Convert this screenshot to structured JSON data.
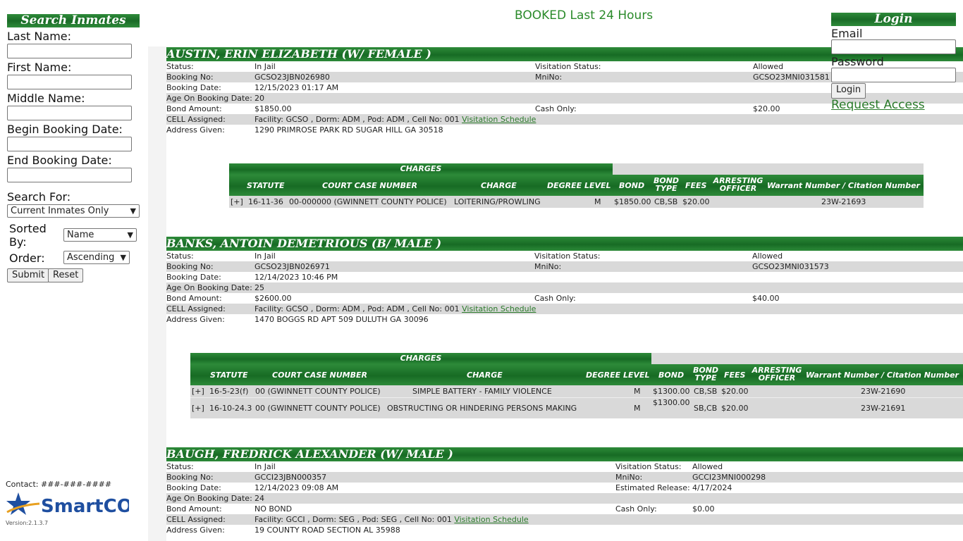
{
  "search_panel": {
    "title": "Search Inmates",
    "last_name_label": "Last Name:",
    "first_name_label": "First Name:",
    "middle_name_label": "Middle Name:",
    "begin_date_label": "Begin Booking Date:",
    "end_date_label": "End Booking Date:",
    "search_for_label": "Search For:",
    "search_for_value": "Current Inmates Only",
    "sorted_by_label": "Sorted By:",
    "sorted_by_value": "Name",
    "order_label": "Order:",
    "order_value": "Ascending",
    "submit_label": "Submit",
    "reset_label": "Reset"
  },
  "footer": {
    "contact": "Contact: ###-###-####",
    "logo_text": "SmartCOP",
    "version": "Version:2.1.3.7"
  },
  "page_title": "BOOKED Last 24 Hours",
  "login": {
    "title": "Login",
    "email_label": "Email",
    "password_label": "Password",
    "login_button": "Login",
    "request_access": "Request Access"
  },
  "labels": {
    "status": "Status:",
    "booking_no": "Booking No:",
    "booking_date": "Booking Date:",
    "age": "Age On Booking Date:",
    "bond_amount": "Bond Amount:",
    "cell": "CELL Assigned:",
    "address": "Address Given:",
    "visitation_status": "Visitation Status:",
    "mnino": "MniNo:",
    "cash_only": "Cash Only:",
    "estimated_release": "Estimated Release:",
    "visitation_schedule": "Visitation Schedule"
  },
  "charge_headers": {
    "charges": "CHARGES",
    "statute": "STATUTE",
    "court_case": "COURT CASE NUMBER",
    "charge": "CHARGE",
    "degree": "DEGREE LEVEL",
    "bond": "BOND",
    "bond_type": "BOND TYPE",
    "fees": "FEES",
    "officer": "ARRESTING OFFICER",
    "warrant": "Warrant Number / Citation Number"
  },
  "inmates": [
    {
      "name": "AUSTIN, ERIN ELIZABETH   (W/ FEMALE )",
      "status": "In Jail",
      "booking_no": "GCSO23JBN026980",
      "booking_date": "12/15/2023 01:17 AM",
      "age": "20",
      "bond_amount": "$1850.00",
      "cell": "Facility: GCSO , Dorm: ADM , Pod: ADM , Cell No: 001",
      "address": "1290 PRIMROSE PARK RD SUGAR HILL GA 30518",
      "visitation_status": "Allowed",
      "mnino": "GCSO23MNI031581",
      "cash_only": "$20.00",
      "charges": [
        {
          "expand": "[+]",
          "statute": "16-11-36",
          "court_case": "00-000000 (GWINNETT COUNTY POLICE)",
          "charge": "LOITERING/PROWLING",
          "degree": "M",
          "bond": "$1850.00",
          "bond_type": "CB,SB",
          "fees": "$20.00",
          "officer": "",
          "warrant": "23W-21693"
        }
      ]
    },
    {
      "name": "BANKS, ANTOIN DEMETRIOUS   (B/ MALE )",
      "status": "In Jail",
      "booking_no": "GCSO23JBN026971",
      "booking_date": "12/14/2023 10:46 PM",
      "age": "25",
      "bond_amount": "$2600.00",
      "cell": "Facility: GCSO , Dorm: ADM , Pod: ADM , Cell No: 001",
      "address": "1470 BOGGS RD APT 509 DULUTH GA 30096",
      "visitation_status": "Allowed",
      "mnino": "GCSO23MNI031573",
      "cash_only": "$40.00",
      "charges": [
        {
          "expand": "[+]",
          "statute": "16-5-23(f)",
          "court_case": "00 (GWINNETT COUNTY POLICE)",
          "charge": "SIMPLE BATTERY - FAMILY VIOLENCE",
          "degree": "M",
          "bond": "$1300.00",
          "bond_type": "CB,SB",
          "fees": "$20.00",
          "officer": "",
          "warrant": "23W-21690"
        },
        {
          "expand": "[+]",
          "statute": "16-10-24.3",
          "court_case": "00 (GWINNETT COUNTY POLICE)",
          "charge": "OBSTRUCTING OR HINDERING PERSONS MAKING",
          "degree": "M",
          "bond": "$1300.00",
          "bond_type": "SB,CB",
          "fees": "$20.00",
          "officer": "",
          "warrant": "23W-21691"
        }
      ]
    },
    {
      "name": "BAUGH, FREDRICK ALEXANDER   (W/ MALE )",
      "status": "In Jail",
      "booking_no": "GCCI23JBN000357",
      "booking_date": "12/14/2023 09:08 AM",
      "age": "24",
      "bond_amount": "NO BOND",
      "cell": "Facility: GCCI , Dorm: SEG , Pod: SEG , Cell No: 001",
      "address": "19 COUNTY ROAD SECTION AL 35988",
      "visitation_status": "Allowed",
      "mnino": "GCCI23MNI000298",
      "estimated_release": "4/17/2024",
      "cash_only": "$0.00"
    }
  ]
}
